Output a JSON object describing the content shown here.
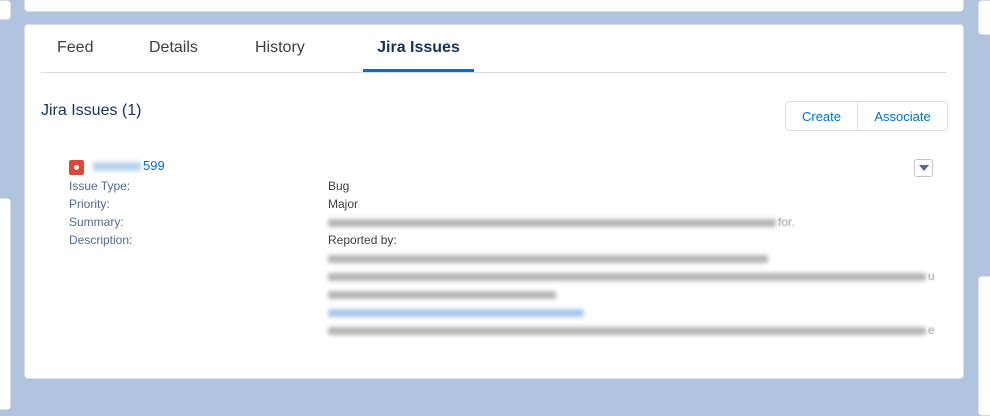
{
  "tabs": [
    "Feed",
    "Details",
    "History",
    "Jira Issues"
  ],
  "active_tab": "Jira Issues",
  "section": {
    "title": "Jira Issues (1)"
  },
  "actions": {
    "create": "Create",
    "associate": "Associate"
  },
  "issue": {
    "key_suffix": "599",
    "fields": [
      {
        "label": "Issue Type:",
        "value": "Bug"
      },
      {
        "label": "Priority:",
        "value": "Major"
      },
      {
        "label": "Summary:",
        "value": ""
      },
      {
        "label": "Description:",
        "value": "Reported by:"
      }
    ],
    "summary_tail": "for.",
    "line2_tail": "u",
    "line_last_tail": "e"
  },
  "colors": {
    "background": "#b0c4df",
    "accent": "#0070d2",
    "bug": "#d9483b"
  }
}
